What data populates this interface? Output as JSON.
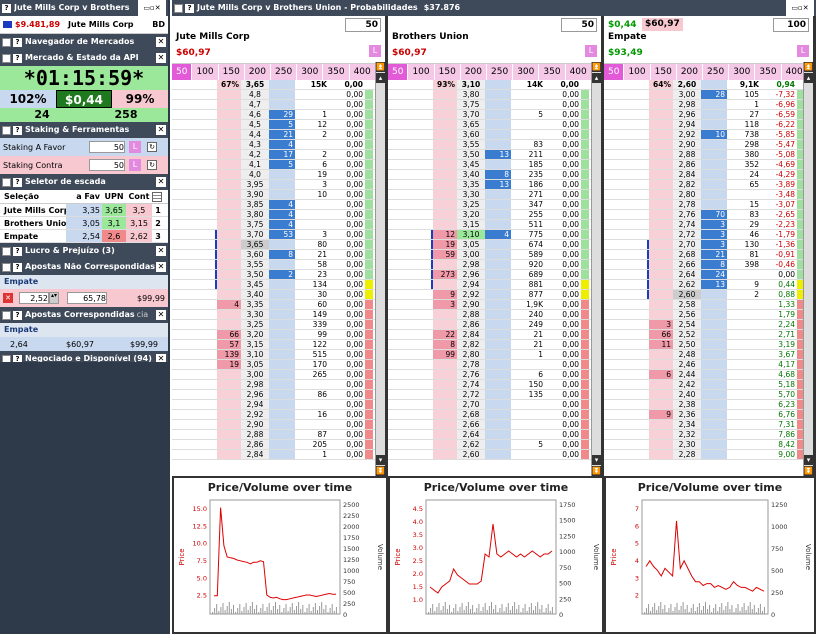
{
  "topbar": {
    "title": "Jute Mills Corp v Brothers",
    "balance": "$9.481,89",
    "selection": "Jute Mills Corp",
    "region": "BD"
  },
  "main_title": "Jute Mills Corp v Brothers Union - Probabilidades",
  "main_total": "$37.876",
  "nav": {
    "title": "Navegador de Mercados"
  },
  "api": {
    "title": "Mercado & Estado da API",
    "timer": "*01:15:59*",
    "left_pct": "102%",
    "center_val": "$0,44",
    "right_pct": "99%",
    "count_left": "24",
    "count_right": "258"
  },
  "staking": {
    "title": "Staking & Ferramentas",
    "favor_label": "Staking A Favor",
    "favor_val": "50",
    "contra_label": "Staking Contra",
    "contra_val": "50",
    "button": "L"
  },
  "selector": {
    "title": "Seletor de escada",
    "headers": [
      "Seleção",
      "a Fav",
      "UPN",
      "Cont"
    ],
    "rows": [
      {
        "name": "Jute Mills Corp",
        "fav": "3,35",
        "upn": "3,65",
        "cont": "3,5",
        "n": "1"
      },
      {
        "name": "Brothers Union",
        "fav": "3,05",
        "upn": "3,1",
        "cont": "3,15",
        "n": "2"
      },
      {
        "name": "Empate",
        "fav": "2,54",
        "upn": "2,6",
        "cont": "2,62",
        "n": "3"
      }
    ]
  },
  "lucro": {
    "title": "Lucro & Prejuízo (3)"
  },
  "nao_corr": {
    "title": "Apostas Não Correspondidas",
    "label": "Empate",
    "odd": "2,52",
    "stake": "65,78",
    "liab": "$99,99"
  },
  "corr": {
    "title": "Apostas Correspondidas",
    "suffix": "cia",
    "label": "Empate",
    "odd": "2,64",
    "stake": "$60,97",
    "liab": "$99,99"
  },
  "negociado": {
    "title": "Negociado e Disponível (94)"
  },
  "stakes": [
    "50",
    "100",
    "150",
    "200",
    "250",
    "300",
    "350",
    "400",
    "450"
  ],
  "markets": [
    {
      "name": "Jute Mills Corp",
      "price": "$60,97",
      "price_color": "red",
      "stake": "50",
      "pre": "",
      "lastp": "3,65",
      "pct": "67%",
      "vol": "15K",
      "pnl": "0,00",
      "rows": [
        [
          "",
          "4,8",
          "",
          "",
          "0,00"
        ],
        [
          "",
          "4,7",
          "",
          "",
          "0,00"
        ],
        [
          "",
          "4,6",
          "29",
          "1",
          "0,00"
        ],
        [
          "",
          "4,5",
          "5",
          "12",
          "0,00"
        ],
        [
          "",
          "4,4",
          "21",
          "2",
          "0,00"
        ],
        [
          "",
          "4,3",
          "4",
          "",
          "0,00"
        ],
        [
          "",
          "4,2",
          "17",
          "2",
          "0,00"
        ],
        [
          "",
          "4,1",
          "5",
          "6",
          "0,00"
        ],
        [
          "",
          "4,0",
          "",
          "19",
          "0,00"
        ],
        [
          "",
          "3,95",
          "",
          "3",
          "0,00"
        ],
        [
          "",
          "3,90",
          "",
          "10",
          "0,00"
        ],
        [
          "",
          "3,85",
          "4",
          "",
          "0,00"
        ],
        [
          "",
          "3,80",
          "4",
          "",
          "0,00"
        ],
        [
          "",
          "3,75",
          "4",
          "",
          "0,00"
        ],
        [
          "",
          "3,70",
          "53",
          "3",
          "0,00"
        ],
        [
          "",
          "3,65",
          "",
          "80",
          "0,00"
        ],
        [
          "",
          "3,60",
          "8",
          "21",
          "0,00"
        ],
        [
          "",
          "3,55",
          "",
          "58",
          "0,00"
        ],
        [
          "",
          "3,50",
          "2",
          "23",
          "0,00"
        ],
        [
          "",
          "3,45",
          "",
          "134",
          "0,00"
        ],
        [
          "",
          "3,40",
          "",
          "30",
          "0,00"
        ],
        [
          "4",
          "3,35",
          "",
          "60",
          "0,00"
        ],
        [
          "",
          "3,30",
          "",
          "149",
          "0,00"
        ],
        [
          "",
          "3,25",
          "",
          "339",
          "0,00"
        ],
        [
          "66",
          "3,20",
          "",
          "99",
          "0,00"
        ],
        [
          "57",
          "3,15",
          "",
          "122",
          "0,00"
        ],
        [
          "139",
          "3,10",
          "",
          "515",
          "0,00"
        ],
        [
          "19",
          "3,05",
          "",
          "170",
          "0,00"
        ],
        [
          "",
          "3,00",
          "",
          "265",
          "0,00"
        ],
        [
          "",
          "2,98",
          "",
          "",
          "0,00"
        ],
        [
          "",
          "2,96",
          "",
          "86",
          "0,00"
        ],
        [
          "",
          "2,94",
          "",
          "",
          "0,00"
        ],
        [
          "",
          "2,92",
          "",
          "16",
          "0,00"
        ],
        [
          "",
          "2,90",
          "",
          "",
          "0,00"
        ],
        [
          "",
          "2,88",
          "",
          "87",
          "0,00"
        ],
        [
          "",
          "2,86",
          "",
          "205",
          "0,00"
        ],
        [
          "",
          "2,84",
          "",
          "1",
          "0,00"
        ]
      ]
    },
    {
      "name": "Brothers Union",
      "price": "$60,97",
      "price_color": "red",
      "stake": "50",
      "pre": "",
      "lastp": "3,10",
      "pct": "93%",
      "vol": "14K",
      "pnl": "0,00",
      "rows": [
        [
          "",
          "3,80",
          "",
          "",
          "0,00"
        ],
        [
          "",
          "3,75",
          "",
          "",
          "0,00"
        ],
        [
          "",
          "3,70",
          "",
          "5",
          "0,00"
        ],
        [
          "",
          "3,65",
          "",
          "",
          "0,00"
        ],
        [
          "",
          "3,60",
          "",
          "",
          "0,00"
        ],
        [
          "",
          "3,55",
          "",
          "83",
          "0,00"
        ],
        [
          "",
          "3,50",
          "13",
          "211",
          "0,00"
        ],
        [
          "",
          "3,45",
          "",
          "185",
          "0,00"
        ],
        [
          "",
          "3,40",
          "8",
          "235",
          "0,00"
        ],
        [
          "",
          "3,35",
          "13",
          "186",
          "0,00"
        ],
        [
          "",
          "3,30",
          "",
          "271",
          "0,00"
        ],
        [
          "",
          "3,25",
          "",
          "347",
          "0,00"
        ],
        [
          "",
          "3,20",
          "",
          "255",
          "0,00"
        ],
        [
          "",
          "3,15",
          "",
          "511",
          "0,00"
        ],
        [
          "12",
          "3,10",
          "4",
          "775",
          "0,00"
        ],
        [
          "19",
          "3,05",
          "",
          "674",
          "0,00"
        ],
        [
          "59",
          "3,00",
          "",
          "589",
          "0,00"
        ],
        [
          "",
          "2,98",
          "",
          "920",
          "0,00"
        ],
        [
          "273",
          "2,96",
          "",
          "689",
          "0,00"
        ],
        [
          "",
          "2,94",
          "",
          "881",
          "0,00"
        ],
        [
          "9",
          "2,92",
          "",
          "877",
          "0,00"
        ],
        [
          "3",
          "2,90",
          "",
          "1,9K",
          "0,00"
        ],
        [
          "",
          "2,88",
          "",
          "240",
          "0,00"
        ],
        [
          "",
          "2,86",
          "",
          "249",
          "0,00"
        ],
        [
          "22",
          "2,84",
          "",
          "21",
          "0,00"
        ],
        [
          "8",
          "2,82",
          "",
          "21",
          "0,00"
        ],
        [
          "99",
          "2,80",
          "",
          "1",
          "0,00"
        ],
        [
          "",
          "2,78",
          "",
          "",
          "0,00"
        ],
        [
          "",
          "2,76",
          "",
          "6",
          "0,00"
        ],
        [
          "",
          "2,74",
          "",
          "150",
          "0,00"
        ],
        [
          "",
          "2,72",
          "",
          "135",
          "0,00"
        ],
        [
          "",
          "2,70",
          "",
          "",
          "0,00"
        ],
        [
          "",
          "2,68",
          "",
          "",
          "0,00"
        ],
        [
          "",
          "2,66",
          "",
          "",
          "0,00"
        ],
        [
          "",
          "2,64",
          "",
          "",
          "0,00"
        ],
        [
          "",
          "2,62",
          "",
          "5",
          "0,00"
        ],
        [
          "",
          "2,60",
          "",
          "",
          "0,00"
        ]
      ]
    },
    {
      "name": "Empate",
      "price": "$93,49",
      "price_color": "green",
      "stake": "100",
      "pre": "$0,44",
      "pre2": "$60,97",
      "lastp": "2,60",
      "pct": "64%",
      "vol": "9,1K",
      "pnl": "0,94",
      "rows": [
        [
          "",
          "3,00",
          "28",
          "105",
          "-7,32"
        ],
        [
          "",
          "2,98",
          "",
          "1",
          "-6,96"
        ],
        [
          "",
          "2,96",
          "",
          "27",
          "-6,59"
        ],
        [
          "",
          "2,94",
          "",
          "118",
          "-6,22"
        ],
        [
          "",
          "2,92",
          "10",
          "738",
          "-5,85"
        ],
        [
          "",
          "2,90",
          "",
          "298",
          "-5,47"
        ],
        [
          "",
          "2,88",
          "",
          "380",
          "-5,08"
        ],
        [
          "",
          "2,86",
          "",
          "352",
          "-4,69"
        ],
        [
          "",
          "2,84",
          "",
          "24",
          "-4,29"
        ],
        [
          "",
          "2,82",
          "",
          "65",
          "-3,89"
        ],
        [
          "",
          "2,80",
          "",
          "",
          "-3,48"
        ],
        [
          "",
          "2,78",
          "",
          "15",
          "-3,07"
        ],
        [
          "",
          "2,76",
          "70",
          "83",
          "-2,65"
        ],
        [
          "",
          "2,74",
          "3",
          "29",
          "-2,23"
        ],
        [
          "",
          "2,72",
          "3",
          "46",
          "-1,79"
        ],
        [
          "",
          "2,70",
          "3",
          "130",
          "-1,36"
        ],
        [
          "",
          "2,68",
          "21",
          "81",
          "-0,91"
        ],
        [
          "",
          "2,66",
          "8",
          "398",
          "-0,46"
        ],
        [
          "",
          "2,64",
          "24",
          "",
          "0,00"
        ],
        [
          "",
          "2,62",
          "13",
          "9",
          "0,44"
        ],
        [
          "",
          "2,60",
          "",
          "2",
          "0,88"
        ],
        [
          "",
          "2,58",
          "",
          "",
          "1,33"
        ],
        [
          "",
          "2,56",
          "",
          "",
          "1,79"
        ],
        [
          "3",
          "2,54",
          "",
          "",
          "2,24"
        ],
        [
          "66",
          "2,52",
          "",
          "",
          "2,71"
        ],
        [
          "11",
          "2,50",
          "",
          "",
          "3,19"
        ],
        [
          "",
          "2,48",
          "",
          "",
          "3,67"
        ],
        [
          "",
          "2,46",
          "",
          "",
          "4,17"
        ],
        [
          "6",
          "2,44",
          "",
          "",
          "4,68"
        ],
        [
          "",
          "2,42",
          "",
          "",
          "5,18"
        ],
        [
          "",
          "2,40",
          "",
          "",
          "5,70"
        ],
        [
          "",
          "2,38",
          "",
          "",
          "6,23"
        ],
        [
          "9",
          "2,36",
          "",
          "",
          "6,76"
        ],
        [
          "",
          "2,34",
          "",
          "",
          "7,31"
        ],
        [
          "",
          "2,32",
          "",
          "",
          "7,86"
        ],
        [
          "",
          "2,30",
          "",
          "",
          "8,42"
        ],
        [
          "",
          "2,28",
          "",
          "",
          "9,00"
        ]
      ]
    }
  ],
  "charts": [
    {
      "title": "Price/Volume over time",
      "ylabel": "Price",
      "y2label": "Volume",
      "yticks": [
        "15.0",
        "12.5",
        "10.0",
        "7.5",
        "5.0",
        "2.5"
      ],
      "y2ticks": [
        "2500",
        "2250",
        "2000",
        "1750",
        "1500",
        "1250",
        "1000",
        "750",
        "500",
        "250",
        "0"
      ],
      "chart_data": {
        "type": "line",
        "series": [
          {
            "name": "",
            "values": [
              3.4,
              3.4,
              15,
              10,
              8.5,
              8.4,
              8.3,
              8.1,
              8.0,
              7.9,
              7.8,
              7.6,
              7.8,
              7.8,
              8.0,
              7.9,
              3.5,
              3.2,
              3.1,
              3.2,
              3.0,
              2.9,
              2.9,
              3.0,
              3.1,
              3.2,
              3.3,
              3.4,
              3.5,
              3.5,
              3.4,
              3.3,
              3.4,
              3.5,
              3.6,
              3.7,
              3.6,
              3.6
            ]
          }
        ],
        "ylim": [
          1,
          16
        ]
      }
    },
    {
      "title": "Price/Volume over time",
      "ylabel": "Price",
      "y2label": "Volume",
      "yticks": [
        "4.5",
        "4.0",
        "3.5",
        "3.0",
        "2.5",
        "2.0",
        "1.5",
        "1.0"
      ],
      "y2ticks": [
        "1750",
        "1500",
        "1250",
        "1000",
        "750",
        "500",
        "250",
        "0"
      ],
      "chart_data": {
        "type": "line",
        "series": [
          {
            "name": "",
            "values": [
              1.9,
              1.8,
              1.7,
              1.9,
              2.0,
              2.1,
              2.5,
              2.3,
              2.2,
              2.1,
              2.0,
              2.0,
              2.0,
              2.1,
              3.0,
              2.9,
              4.0,
              3.0,
              2.9,
              3.0,
              3.1,
              3.0,
              2.9,
              3.0,
              2.9,
              3.0,
              3.1,
              3.0,
              2.9,
              3.0,
              3.0,
              3.1
            ]
          }
        ],
        "ylim": [
          1,
          4.8
        ]
      }
    },
    {
      "title": "Price/Volume over time",
      "ylabel": "Price",
      "y2label": "Volume",
      "yticks": [
        "7",
        "6",
        "5",
        "4",
        "3",
        "2"
      ],
      "y2ticks": [
        "1250",
        "1000",
        "750",
        "500",
        "250",
        "0"
      ],
      "chart_data": {
        "type": "line",
        "series": [
          {
            "name": "",
            "values": [
              4.0,
              4.3,
              4.0,
              3.8,
              3.5,
              3.9,
              3.7,
              3.5,
              6.4,
              3.9,
              4.3,
              3.9,
              3.5,
              3.2,
              3.2,
              3.0,
              3.1,
              3.1,
              2.9,
              3.0,
              2.9,
              2.8,
              2.9,
              3.2,
              3.0,
              2.9,
              2.9,
              2.8,
              2.7,
              2.9,
              2.8,
              2.7
            ]
          }
        ],
        "ylim": [
          1.5,
          7.5
        ]
      }
    }
  ]
}
